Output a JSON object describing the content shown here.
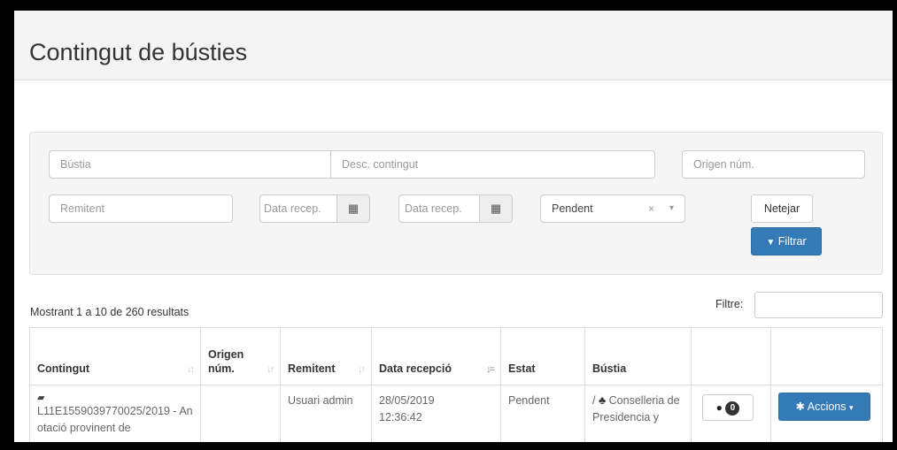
{
  "page": {
    "title": "Contingut de bústies"
  },
  "filters": {
    "bustia_placeholder": "Bústia",
    "desc_placeholder": "Desc. contingut",
    "origen_placeholder": "Origen núm.",
    "remitent_placeholder": "Remitent",
    "data_from_placeholder": "Data recep.",
    "data_to_placeholder": "Data recep.",
    "estat_value": "Pendent",
    "clear_symbol": "×",
    "caret_symbol": "▾",
    "netejar_label": "Netejar",
    "filtrar_label": "Filtrar"
  },
  "results": {
    "summary": "Mostrant 1 a 10 de 260 resultats",
    "filter_label": "Filtre:"
  },
  "table": {
    "columns": [
      "Contingut",
      "Origen núm.",
      "Remitent",
      "Data recepció",
      "Estat",
      "Bústia",
      "",
      ""
    ],
    "rows": [
      {
        "contingut": "L11E1559039770025/2019 - Anotació provinent de",
        "origen": "",
        "remitent": "Usuari admin",
        "data": "28/05/2019 12:36:42",
        "estat": "Pendent",
        "bustia_prefix": "/",
        "bustia": "Conselleria de Presidencia y",
        "messages_count": "0",
        "accions_label": "Accions"
      }
    ]
  },
  "colors": {
    "primary": "#337ab7",
    "header_bg": "#f4f4f4",
    "panel_bg": "#f5f5f5"
  }
}
